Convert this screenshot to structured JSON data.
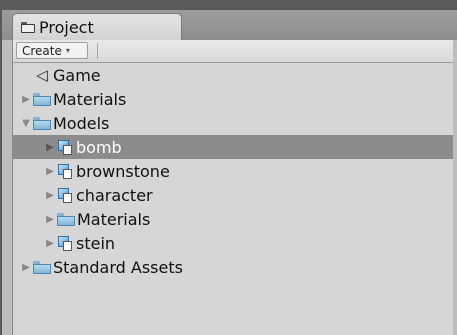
{
  "panel": {
    "tab_label": "Project",
    "create_label": "Create",
    "create_arrow": "▾"
  },
  "tree": {
    "items": [
      {
        "label": "Game",
        "icon": "scene-icon",
        "depth": 0,
        "expander": "none",
        "selected": false
      },
      {
        "label": "Materials",
        "icon": "folder-icon",
        "depth": 0,
        "expander": "collapsed",
        "selected": false
      },
      {
        "label": "Models",
        "icon": "folder-icon",
        "depth": 0,
        "expander": "expanded",
        "selected": false
      },
      {
        "label": "bomb",
        "icon": "model-icon",
        "depth": 1,
        "expander": "collapsed",
        "selected": true
      },
      {
        "label": "brownstone",
        "icon": "model-icon",
        "depth": 1,
        "expander": "collapsed",
        "selected": false
      },
      {
        "label": "character",
        "icon": "model-icon",
        "depth": 1,
        "expander": "collapsed",
        "selected": false
      },
      {
        "label": "Materials",
        "icon": "folder-icon",
        "depth": 1,
        "expander": "collapsed",
        "selected": false
      },
      {
        "label": "stein",
        "icon": "model-icon",
        "depth": 1,
        "expander": "collapsed",
        "selected": false
      },
      {
        "label": "Standard Assets",
        "icon": "folder-icon",
        "depth": 0,
        "expander": "collapsed",
        "selected": false
      }
    ]
  },
  "colors": {
    "selection": "#8c8c8c",
    "panel_bg": "#d6d6d6",
    "folder": "#7fb4d8"
  }
}
